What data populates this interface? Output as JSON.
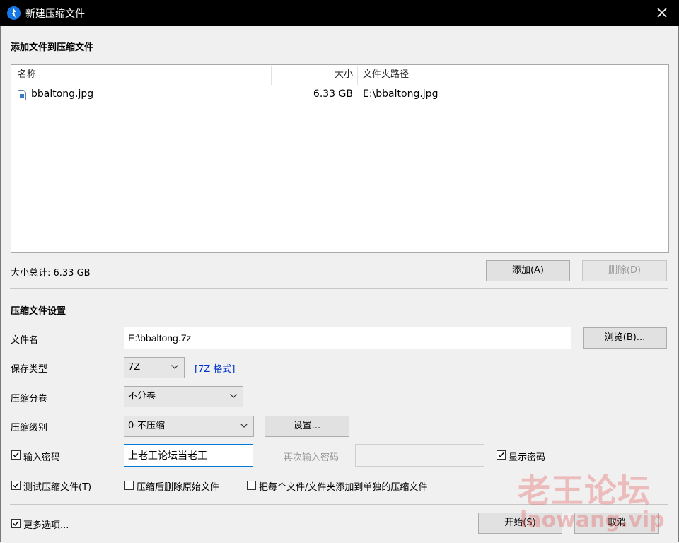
{
  "window": {
    "title": "新建压缩文件",
    "close_icon": "close-icon",
    "app_icon": "bandizip-icon"
  },
  "add_section": {
    "title": "添加文件到压缩文件",
    "columns": {
      "name": "名称",
      "size": "大小",
      "path": "文件夹路径"
    },
    "files": [
      {
        "name": "bbaltong.jpg",
        "size": "6.33 GB",
        "path": "E:\\bbaltong.jpg",
        "icon": "image-file-icon"
      }
    ],
    "total": "大小总计: 6.33 GB",
    "add_button": "添加(A)",
    "delete_button": "删除(D)"
  },
  "settings": {
    "title": "压缩文件设置",
    "filename_label": "文件名",
    "filename_value": "E:\\bbaltong.7z",
    "browse_button": "浏览(B)...",
    "type_label": "保存类型",
    "type_value": "7Z",
    "type_link": "[7Z 格式]",
    "split_label": "压缩分卷",
    "split_value": "不分卷",
    "level_label": "压缩级别",
    "level_value": "0-不压缩",
    "level_settings_button": "设置...",
    "password_label": "输入密码",
    "password_checked": true,
    "password_value": "上老王论坛当老王",
    "password_confirm_label": "再次输入密码",
    "password_confirm_value": "",
    "show_password_label": "显示密码",
    "show_password_checked": true,
    "test_label": "测试压缩文件(T)",
    "test_checked": true,
    "delete_after_label": "压缩后删除原始文件",
    "delete_after_checked": false,
    "each_file_label": "把每个文件/文件夹添加到单独的压缩文件",
    "each_file_checked": false
  },
  "footer": {
    "more_options_label": "更多选项...",
    "more_options_checked": true,
    "start_button": "开始(S)",
    "cancel_button": "取消"
  },
  "watermark": {
    "text": "老王论坛",
    "url": "laowang.vip"
  },
  "colors": {
    "accent": "#0078d7",
    "link": "#0033cc",
    "titlebar": "#000000"
  }
}
